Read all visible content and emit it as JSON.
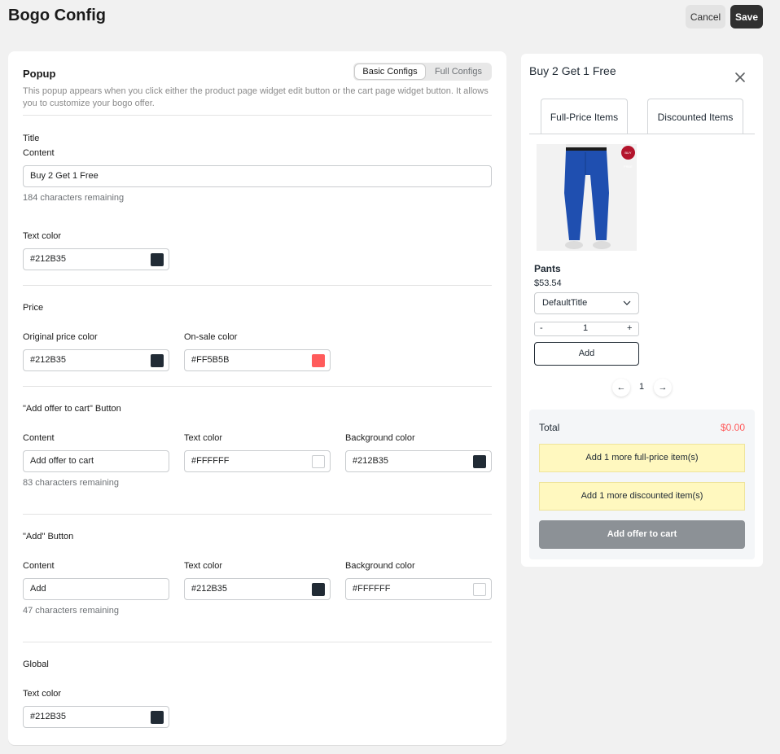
{
  "header": {
    "title": "Bogo Config",
    "cancel_label": "Cancel",
    "save_label": "Save"
  },
  "popup": {
    "title": "Popup",
    "description": "This popup appears when you click either the product page widget edit button or the cart page widget button. It allows you to customize your bogo offer.",
    "tabs": [
      "Basic Configs",
      "Full Configs"
    ]
  },
  "title_section": {
    "heading": "Title",
    "content_label": "Content",
    "content_value": "Buy 2 Get 1 Free",
    "remaining": "184 characters remaining",
    "text_color_label": "Text color",
    "text_color_value": "#212B35"
  },
  "price_section": {
    "heading": "Price",
    "original_label": "Original price color",
    "original_value": "#212B35",
    "sale_label": "On-sale color",
    "sale_value": "#FF5B5B"
  },
  "offer_button_section": {
    "heading": "\"Add offer to cart\" Button",
    "content_label": "Content",
    "content_value": "Add offer to cart",
    "remaining": "83 characters remaining",
    "text_color_label": "Text color",
    "text_color_value": "#FFFFFF",
    "bg_label": "Background color",
    "bg_value": "#212B35"
  },
  "add_button_section": {
    "heading": "\"Add\" Button",
    "content_label": "Content",
    "content_value": "Add",
    "remaining": "47 characters remaining",
    "text_color_label": "Text color",
    "text_color_value": "#212B35",
    "bg_label": "Background color",
    "bg_value": "#FFFFFF"
  },
  "global_section": {
    "heading": "Global",
    "text_color_label": "Text color",
    "text_color_value": "#212B35"
  },
  "preview": {
    "title": "Buy 2 Get 1 Free",
    "tabs": [
      "Full-Price Items",
      "Discounted Items"
    ],
    "product": {
      "name": "Pants",
      "price": "$53.54",
      "variant": "DefaultTitle",
      "qty": "1",
      "minus": "-",
      "plus": "+",
      "add_label": "Add",
      "badge": "BUY FREE"
    },
    "pagination": {
      "prev": "←",
      "page": "1",
      "next": "→"
    },
    "total_label": "Total",
    "total_value": "$0.00",
    "notice_full": "Add 1 more full-price item(s)",
    "notice_discounted": "Add 1 more discounted item(s)",
    "offer_button": "Add offer to cart"
  },
  "colors": {
    "dark": "#212B35",
    "sale": "#FF5B5B",
    "white": "#FFFFFF",
    "notice": "#FFF8BF"
  }
}
